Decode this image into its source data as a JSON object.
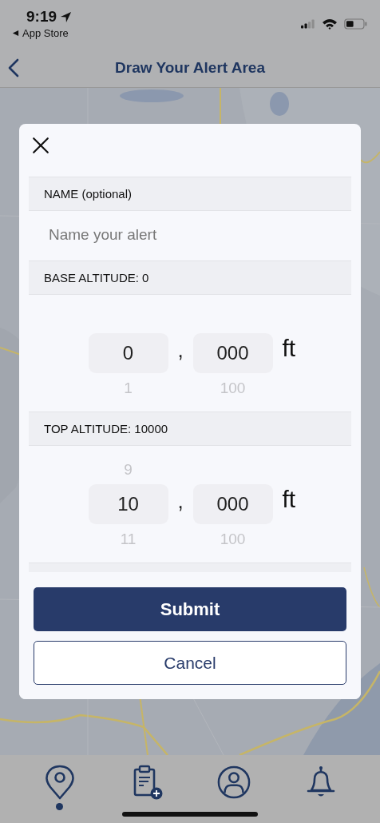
{
  "status_bar": {
    "time": "9:19",
    "back_label": "App Store"
  },
  "nav": {
    "title": "Draw Your Alert Area"
  },
  "dialog": {
    "name_section": {
      "header": "NAME (optional)",
      "placeholder": "Name your alert"
    },
    "altitudes": [
      {
        "header": "BASE ALTITUDE:  0",
        "thousands": {
          "value": "0",
          "below": "1"
        },
        "separator": ",",
        "hundreds": {
          "value": "000",
          "below": "100"
        },
        "unit": "ft"
      },
      {
        "header": "TOP ALTITUDE: 10000",
        "thousands": {
          "above": "9",
          "value": "10",
          "below": "11"
        },
        "separator": ",",
        "hundreds": {
          "value": "000",
          "below": "100"
        },
        "unit": "ft"
      }
    ],
    "submit": "Submit",
    "cancel": "Cancel"
  },
  "tabs": [
    {
      "kind": "pin",
      "selected": true
    },
    {
      "kind": "clipboard",
      "selected": false
    },
    {
      "kind": "profile",
      "selected": false
    },
    {
      "kind": "bell",
      "selected": false
    }
  ]
}
